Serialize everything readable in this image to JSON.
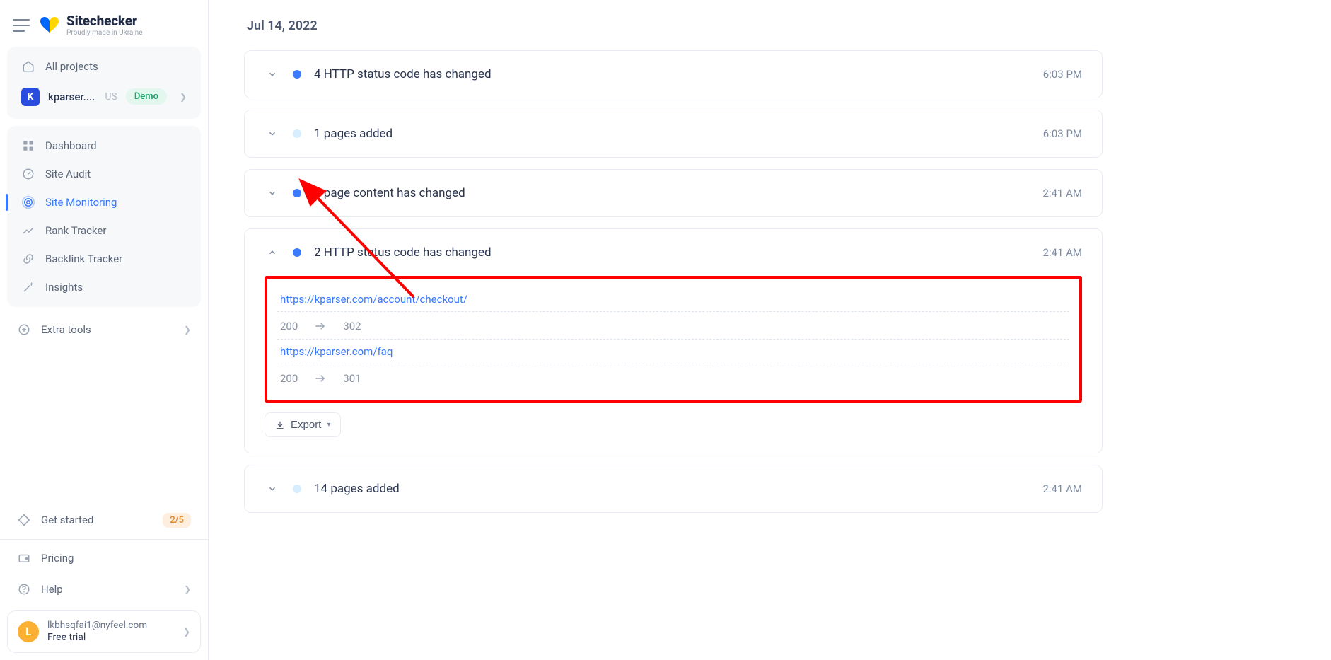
{
  "brand": {
    "name": "Sitechecker",
    "tagline": "Proudly made in Ukraine"
  },
  "nav": {
    "all_projects": "All projects",
    "project": {
      "letter": "K",
      "domain": "kparser....",
      "cc": "US",
      "badge": "Demo"
    },
    "items": {
      "dashboard": "Dashboard",
      "site_audit": "Site Audit",
      "site_monitoring": "Site Monitoring",
      "rank_tracker": "Rank Tracker",
      "backlink_tracker": "Backlink Tracker",
      "insights": "Insights"
    },
    "extra_tools": "Extra tools",
    "get_started": {
      "label": "Get started",
      "count": "2/5"
    },
    "pricing": "Pricing",
    "help": "Help"
  },
  "user": {
    "initial": "L",
    "email": "lkbhsqfai1@nyfeel.com",
    "plan": "Free trial"
  },
  "feed": {
    "date": "Jul 14, 2022",
    "export_label": "Export",
    "events": [
      {
        "title": "4 HTTP status code has changed",
        "time": "6:03 PM",
        "dot": "blue",
        "expanded": false
      },
      {
        "title": "1 pages added",
        "time": "6:03 PM",
        "dot": "light",
        "expanded": false
      },
      {
        "title": "1 page content has changed",
        "time": "2:41 AM",
        "dot": "blue",
        "expanded": false
      },
      {
        "title": "2 HTTP status code has changed",
        "time": "2:41 AM",
        "dot": "blue",
        "expanded": true,
        "details": [
          {
            "url": "https://kparser.com/account/checkout/",
            "from": "200",
            "to": "302"
          },
          {
            "url": "https://kparser.com/faq",
            "from": "200",
            "to": "301"
          }
        ]
      },
      {
        "title": "14 pages added",
        "time": "2:41 AM",
        "dot": "light",
        "expanded": false
      }
    ]
  }
}
